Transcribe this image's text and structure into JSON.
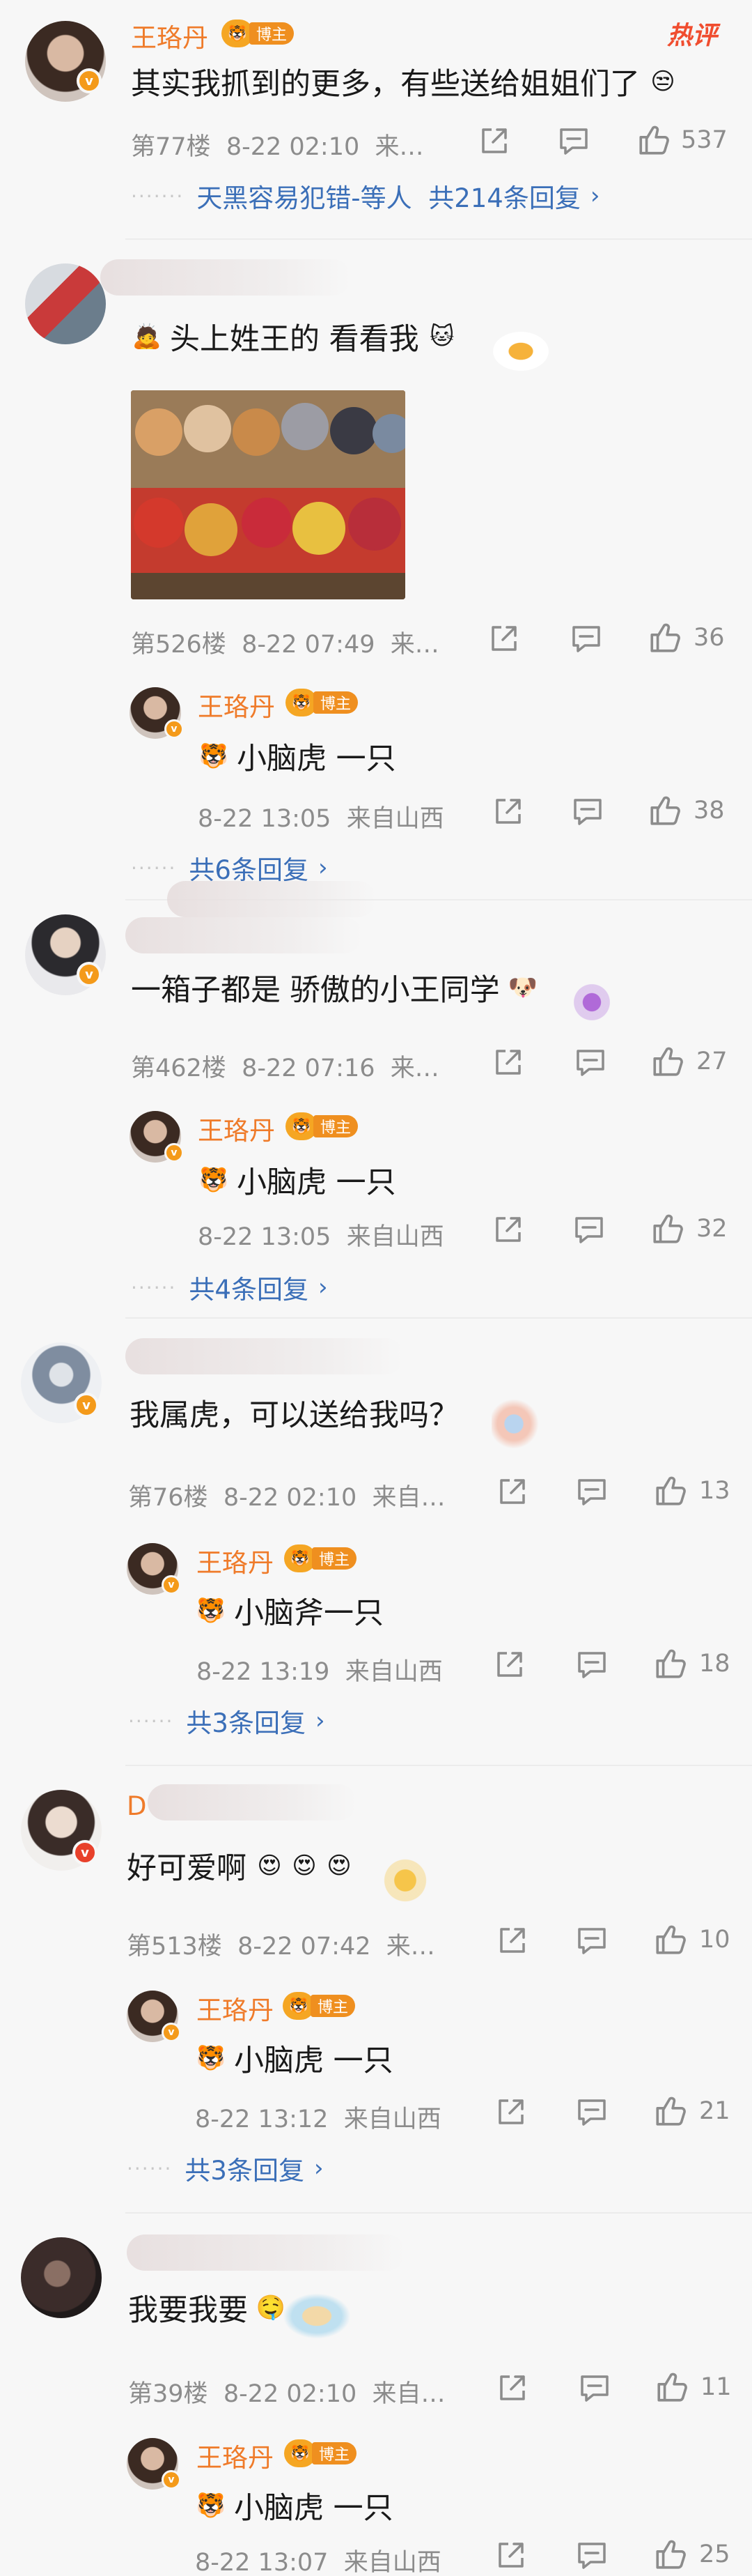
{
  "hot_label": "热评",
  "author_tag": "博主",
  "comments": [
    {
      "name": "王珞丹",
      "text": "其实我抓到的更多，有些送给姐姐们了",
      "floor": "第77楼",
      "time": "8-22 02:10",
      "source": "来…",
      "likes": "537",
      "replies_label": "天黑容易犯错-等人",
      "replies_count": "共214条回复"
    },
    {
      "text": "头上姓王的  看看我",
      "floor": "第526楼",
      "time": "8-22 07:49",
      "source": "来…",
      "likes": "36",
      "reply": {
        "name": "王珞丹",
        "text": "小脑虎 一只",
        "time": "8-22 13:05",
        "source": "来自山西",
        "likes": "38"
      },
      "replies_count": "共6条回复"
    },
    {
      "text": "一箱子都是 骄傲的小王同学",
      "floor": "第462楼",
      "time": "8-22 07:16",
      "source": "来…",
      "likes": "27",
      "reply": {
        "name": "王珞丹",
        "text": "小脑虎 一只",
        "time": "8-22 13:05",
        "source": "来自山西",
        "likes": "32"
      },
      "replies_count": "共4条回复"
    },
    {
      "text": "我属虎，可以送给我吗？",
      "floor": "第76楼",
      "time": "8-22 02:10",
      "source": "来自…",
      "likes": "13",
      "reply": {
        "name": "王珞丹",
        "text": "小脑斧一只",
        "time": "8-22 13:19",
        "source": "来自山西",
        "likes": "18"
      },
      "replies_count": "共3条回复"
    },
    {
      "name_prefix": "D",
      "text": "好可爱啊",
      "floor": "第513楼",
      "time": "8-22 07:42",
      "source": "来…",
      "likes": "10",
      "reply": {
        "name": "王珞丹",
        "text": "小脑虎 一只",
        "time": "8-22 13:12",
        "source": "来自山西",
        "likes": "21"
      },
      "replies_count": "共3条回复"
    },
    {
      "text": "我要我要",
      "floor": "第39楼",
      "time": "8-22 02:10",
      "source": "来自…",
      "likes": "11",
      "reply": {
        "name": "王珞丹",
        "text": "小脑虎 一只",
        "time": "8-22 13:07",
        "source": "来自山西",
        "likes": "25"
      }
    }
  ],
  "colors": {
    "username": "#ef7b2a",
    "link": "#3b6fb8",
    "meta": "#8c8c8c",
    "hot": "#f04d2f"
  }
}
